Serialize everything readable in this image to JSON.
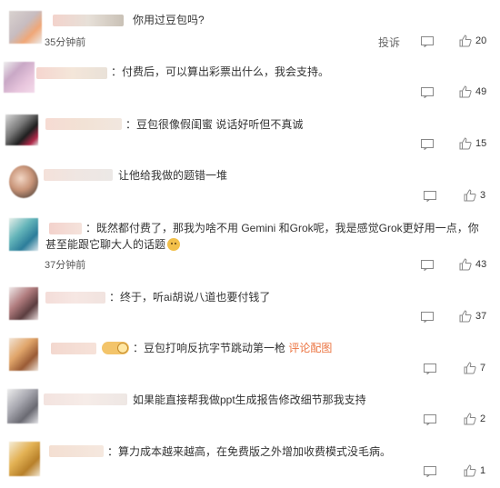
{
  "colors": {
    "link": "#eb7340",
    "text": "#333333",
    "meta": "#555555"
  },
  "actions": {
    "report_label": "投诉"
  },
  "comments": [
    {
      "text": "你用过豆包吗?",
      "time": "35分钟前",
      "likes": "20"
    },
    {
      "text": "：付费后，可以算出彩票出什么，我会支持。",
      "likes": "49"
    },
    {
      "text": "：豆包很像假闺蜜 说话好听但不真诚",
      "likes": "15"
    },
    {
      "text": "让他给我做的题错一堆",
      "likes": "3"
    },
    {
      "text": "：既然都付费了，那我为啥不用 Gemini 和Grok呢，我是感觉Grok更好用一点，你甚至能跟它聊大人的话题",
      "time": "37分钟前",
      "likes": "43"
    },
    {
      "text": "：终于，听ai胡说八道也要付钱了",
      "likes": "37"
    },
    {
      "text": "：豆包打响反抗字节跳动第一枪",
      "link": "评论配图",
      "likes": "7"
    },
    {
      "text": "如果能直接帮我做ppt生成报告修改细节那我支持",
      "likes": "2"
    },
    {
      "text": "：算力成本越来越高，在免费版之外增加收费模式没毛病。",
      "likes": "1"
    }
  ]
}
